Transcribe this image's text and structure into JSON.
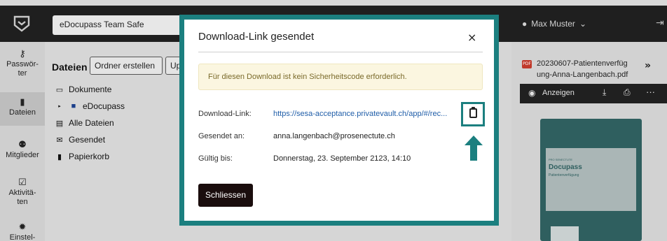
{
  "topbar": {
    "team": "eDocupass Team Safe",
    "user": "Max Muster"
  },
  "nav": {
    "items": [
      {
        "label": "Passwör-\nter",
        "icon": "key-icon"
      },
      {
        "label": "Dateien",
        "icon": "file-icon"
      },
      {
        "label": "Mitglieder",
        "icon": "users-icon"
      },
      {
        "label": "Aktivitä-\nten",
        "icon": "calendar-check-icon"
      },
      {
        "label": "Einstel-",
        "icon": "gear-icon"
      }
    ]
  },
  "files": {
    "title": "Dateien",
    "create_folder": "Ordner erstellen",
    "upload_partial": "Up",
    "tree": [
      {
        "label": "Dokumente"
      },
      {
        "label": "eDocupass"
      },
      {
        "label": "Alle Dateien"
      },
      {
        "label": "Gesendet"
      },
      {
        "label": "Papierkorb"
      }
    ]
  },
  "preview": {
    "pdf_badge": "PDF",
    "file_name": "20230607-Patientenverfüg ung-Anna-Langenbach.pdf",
    "show_label": "Anzeigen",
    "doc_title": "Docupass",
    "doc_subtitle": "Patientenverfügung",
    "doc_small": "PRO SENECTUTE"
  },
  "modal": {
    "title": "Download-Link gesendet",
    "close": "×",
    "notice": "Für diesen Download ist kein Sicherheitscode erforderlich.",
    "link_label": "Download-Link:",
    "link_value": "https://sesa-acceptance.privatevault.ch/app/#/rec...",
    "sent_label": "Gesendet an:",
    "sent_value": "anna.langenbach@prosenectute.ch",
    "valid_label": "Gültig bis:",
    "valid_value": "Donnerstag, 23. September 2123, 14:10",
    "button": "Schliessen"
  },
  "colors": {
    "accent": "#1b7f7f",
    "link": "#1f5da8",
    "notice_bg": "#fbf6e0"
  }
}
